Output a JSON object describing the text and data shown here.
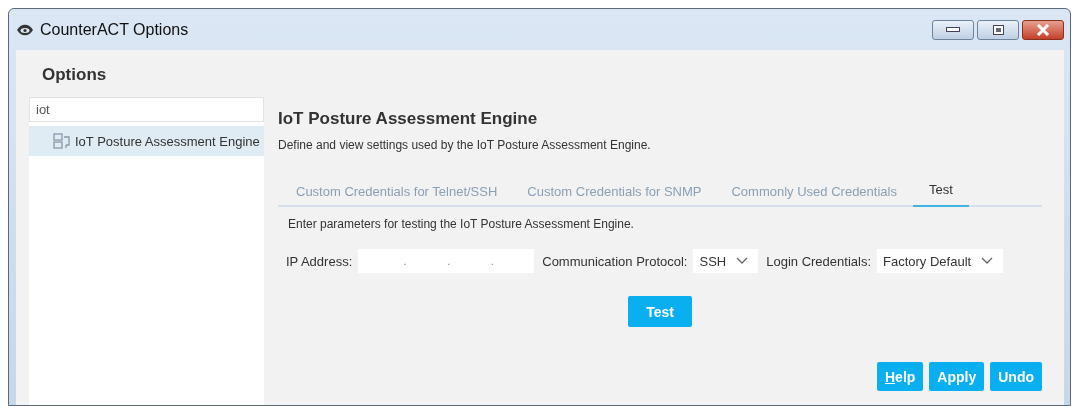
{
  "window": {
    "title": "CounterACT Options"
  },
  "options_heading": "Options",
  "sidebar": {
    "search": {
      "value": "iot"
    },
    "items": [
      {
        "label": "IoT Posture Assessment Engine",
        "selected": true
      }
    ]
  },
  "panel": {
    "title": "IoT Posture Assessment Engine",
    "description": "Define and view settings used by the IoT Posture Assessment Engine.",
    "tabs": [
      {
        "label": "Custom Credentials for Telnet/SSH",
        "selected": false
      },
      {
        "label": "Custom Credentials for SNMP",
        "selected": false
      },
      {
        "label": "Commonly Used Credentials",
        "selected": false
      },
      {
        "label": "Test",
        "selected": true
      }
    ],
    "instructions": "Enter parameters for testing the IoT Posture Assessment Engine.",
    "fields": [
      {
        "kind": "ip",
        "label": "IP Address:",
        "separators": [
          ".",
          ".",
          "."
        ]
      },
      {
        "kind": "select",
        "label": "Communication Protocol:",
        "value": "SSH"
      },
      {
        "kind": "select",
        "label": "Login Credentials:",
        "value": "Factory Default"
      }
    ],
    "test_button": "Test"
  },
  "buttons": [
    {
      "label": "Help",
      "underline_first": true
    },
    {
      "label": "Apply",
      "underline_first": false
    },
    {
      "label": "Undo",
      "underline_first": false
    }
  ]
}
